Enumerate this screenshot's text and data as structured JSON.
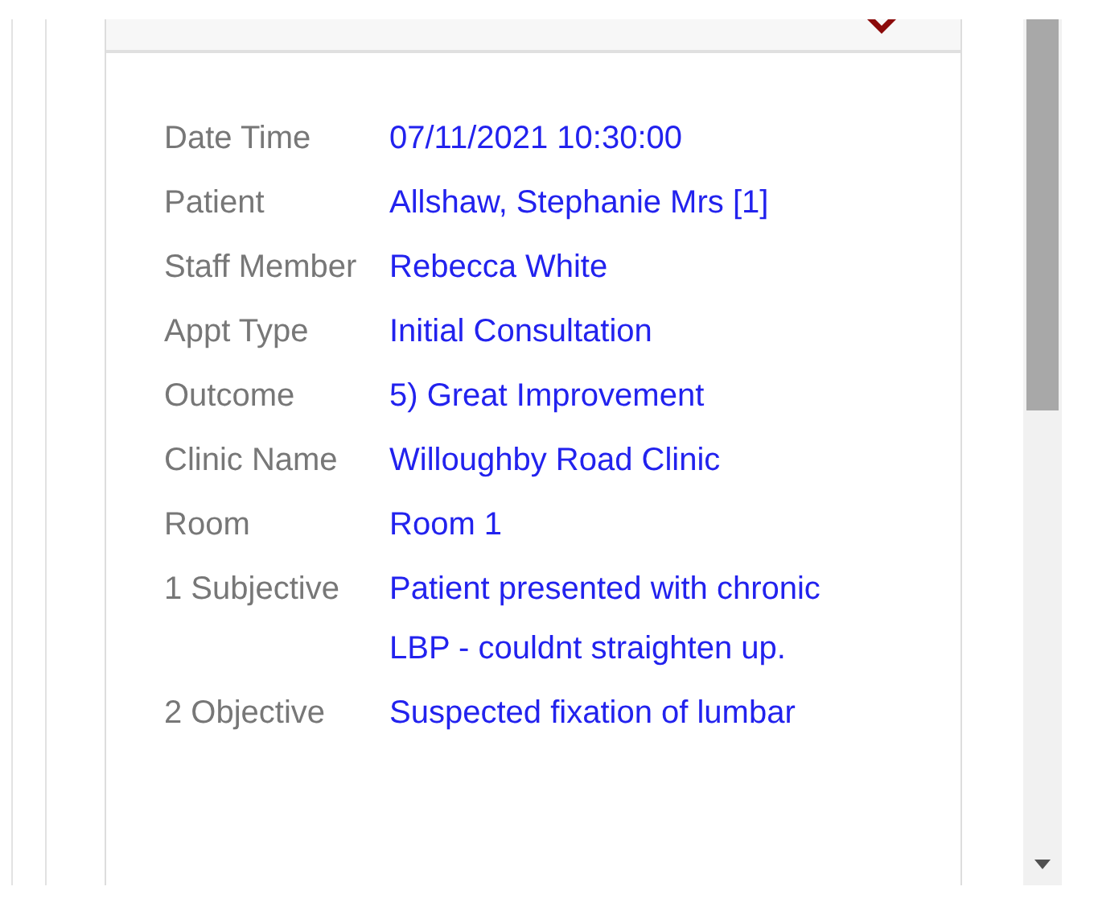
{
  "details": [
    {
      "label": "Date Time",
      "value": "07/11/2021 10:30:00"
    },
    {
      "label": "Patient",
      "value": "Allshaw, Stephanie Mrs [1]"
    },
    {
      "label": "Staff Member",
      "value": "Rebecca White"
    },
    {
      "label": "Appt Type",
      "value": "Initial Consultation"
    },
    {
      "label": "Outcome",
      "value": "5) Great Improvement"
    },
    {
      "label": "Clinic Name",
      "value": "Willoughby Road Clinic"
    },
    {
      "label": "Room",
      "value": "Room 1"
    },
    {
      "label": "1 Subjective",
      "value": "Patient presented with chronic LBP - couldnt straighten up."
    },
    {
      "label": "2 Objective",
      "value": "Suspected fixation of lumbar"
    }
  ]
}
